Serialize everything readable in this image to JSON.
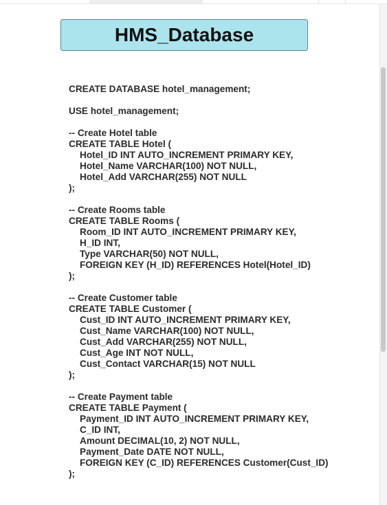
{
  "title": "HMS_Database",
  "code_lines": [
    {
      "text": "CREATE DATABASE hotel_management;",
      "indent": false
    },
    {
      "text": "",
      "indent": false
    },
    {
      "text": "USE hotel_management;",
      "indent": false
    },
    {
      "text": "",
      "indent": false
    },
    {
      "text": "-- Create Hotel table",
      "indent": false
    },
    {
      "text": "CREATE TABLE Hotel (",
      "indent": false
    },
    {
      "text": "Hotel_ID INT AUTO_INCREMENT PRIMARY KEY,",
      "indent": true
    },
    {
      "text": "Hotel_Name VARCHAR(100) NOT NULL,",
      "indent": true
    },
    {
      "text": "Hotel_Add VARCHAR(255) NOT NULL",
      "indent": true
    },
    {
      "text": ");",
      "indent": false
    },
    {
      "text": "",
      "indent": false
    },
    {
      "text": "-- Create Rooms table",
      "indent": false
    },
    {
      "text": "CREATE TABLE Rooms (",
      "indent": false
    },
    {
      "text": "Room_ID INT AUTO_INCREMENT PRIMARY KEY,",
      "indent": true
    },
    {
      "text": "H_ID INT,",
      "indent": true
    },
    {
      "text": "Type VARCHAR(50) NOT NULL,",
      "indent": true
    },
    {
      "text": "FOREIGN KEY (H_ID) REFERENCES Hotel(Hotel_ID)",
      "indent": true
    },
    {
      "text": ");",
      "indent": false
    },
    {
      "text": "",
      "indent": false
    },
    {
      "text": "-- Create Customer table",
      "indent": false
    },
    {
      "text": "CREATE TABLE Customer (",
      "indent": false
    },
    {
      "text": "Cust_ID INT AUTO_INCREMENT PRIMARY KEY,",
      "indent": true
    },
    {
      "text": "Cust_Name VARCHAR(100) NOT NULL,",
      "indent": true
    },
    {
      "text": "Cust_Add VARCHAR(255) NOT NULL,",
      "indent": true
    },
    {
      "text": "Cust_Age INT NOT NULL,",
      "indent": true
    },
    {
      "text": "Cust_Contact VARCHAR(15) NOT NULL",
      "indent": true
    },
    {
      "text": ");",
      "indent": false
    },
    {
      "text": "",
      "indent": false
    },
    {
      "text": "-- Create Payment table",
      "indent": false
    },
    {
      "text": "CREATE TABLE Payment (",
      "indent": false
    },
    {
      "text": "Payment_ID INT AUTO_INCREMENT PRIMARY KEY,",
      "indent": true
    },
    {
      "text": "C_ID INT,",
      "indent": true
    },
    {
      "text": "Amount DECIMAL(10, 2) NOT NULL,",
      "indent": true
    },
    {
      "text": "Payment_Date DATE NOT NULL,",
      "indent": true
    },
    {
      "text": "FOREIGN KEY (C_ID) REFERENCES Customer(Cust_ID)",
      "indent": true
    },
    {
      "text": ");",
      "indent": false
    }
  ],
  "colors": {
    "title_bg": "#ace4ee",
    "title_border": "#5b7f88",
    "text": "#2a2a2a"
  }
}
